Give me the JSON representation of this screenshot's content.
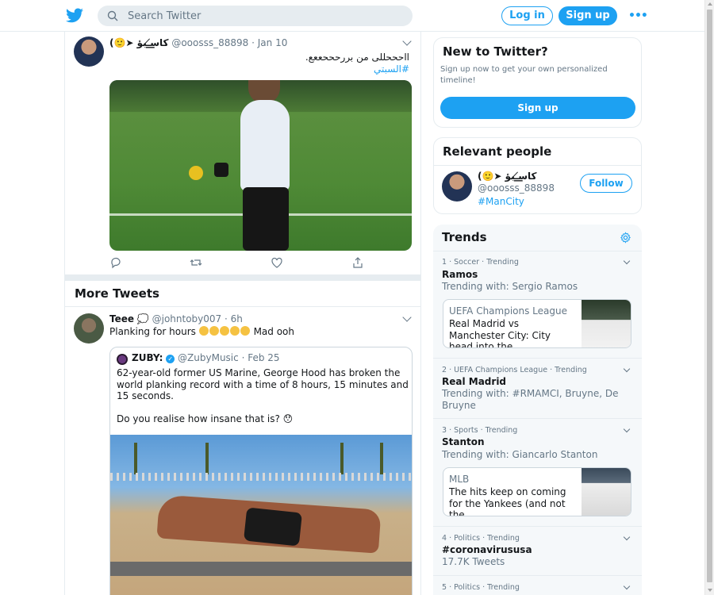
{
  "search": {
    "placeholder": "Search Twitter"
  },
  "nav": {
    "login": "Log in",
    "signup": "Sign up",
    "more": "•••"
  },
  "tweet1": {
    "name": "(🙂➤ كاس̸͟͟͟͟ـبؤ",
    "handle": "@ooosss_88898",
    "date": "Jan 10",
    "text": "ااحححللى من بررحححععع.",
    "hashtag": "#السبتي"
  },
  "more_tweets": {
    "title": "More Tweets"
  },
  "tweet2": {
    "name": "Teee",
    "badge": "💭",
    "handle": "@johntoby007",
    "time": "6h",
    "text_before": "Planking for hours",
    "text_after": "Mad ooh",
    "quote": {
      "name": "ZUBY:",
      "verified": "✓",
      "handle": "@ZubyMusic",
      "date": "Feb 25",
      "text1": "62-year-old former US Marine, George Hood has broken the world planking record with a time of 8 hours, 15 minutes and 15 seconds.",
      "text2": "Do you realise how insane that is? 😯"
    }
  },
  "new_card": {
    "title": "New to Twitter?",
    "subtitle": "Sign up now to get your own personalized timeline!",
    "button": "Sign up"
  },
  "relevant": {
    "title": "Relevant people",
    "name": "(🙂➤ كاس̸͟͟͟͟ـبؤ",
    "handle": "@ooosss_88898",
    "tag": "#ManCity",
    "follow": "Follow"
  },
  "trends": {
    "title": "Trends",
    "items": [
      {
        "meta": "1 · Soccer · Trending",
        "name": "Ramos",
        "sub": "Trending with: Sergio Ramos",
        "story_cat": "UEFA Champions League",
        "story_text": "Real Madrid vs Manchester City: City head into the ..."
      },
      {
        "meta": "2 · UEFA Champions League · Trending",
        "name": "Real Madrid",
        "sub": "Trending with: #RMAMCI, Bruyne, De Bruyne"
      },
      {
        "meta": "3 · Sports · Trending",
        "name": "Stanton",
        "sub": "Trending with: Giancarlo Stanton",
        "story_cat": "MLB",
        "story_text": "The hits keep on coming for the Yankees (and not the ..."
      },
      {
        "meta": "4 · Politics · Trending",
        "name": "#coronavirususa",
        "sub": "17.7K Tweets"
      },
      {
        "meta": "5 · Politics · Trending"
      }
    ]
  }
}
